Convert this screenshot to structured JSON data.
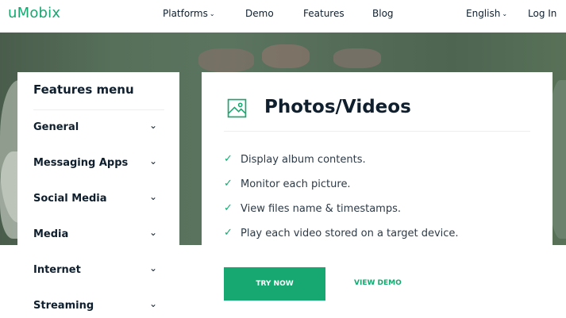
{
  "header": {
    "logo": "uMobix",
    "nav": [
      {
        "label": "Platforms",
        "has_dropdown": true
      },
      {
        "label": "Demo",
        "has_dropdown": false
      },
      {
        "label": "Features",
        "has_dropdown": false
      },
      {
        "label": "Blog",
        "has_dropdown": false
      }
    ],
    "language": {
      "label": "English",
      "has_dropdown": true
    },
    "login": "Log In"
  },
  "features_menu": {
    "title": "Features menu",
    "items": [
      {
        "label": "General"
      },
      {
        "label": "Messaging Apps"
      },
      {
        "label": "Social Media"
      },
      {
        "label": "Media"
      },
      {
        "label": "Internet"
      },
      {
        "label": "Streaming"
      }
    ]
  },
  "content": {
    "icon": "image-icon",
    "title": "Photos/Videos",
    "features": [
      "Display album contents.",
      "Monitor each picture.",
      "View files name & timestamps.",
      "Play each video stored on a target device."
    ],
    "try_button": "TRY NOW",
    "demo_link": "VIEW DEMO"
  },
  "colors": {
    "brand": "#16a870",
    "text_dark": "#0f1f2e",
    "hero_background": "#56705a"
  }
}
